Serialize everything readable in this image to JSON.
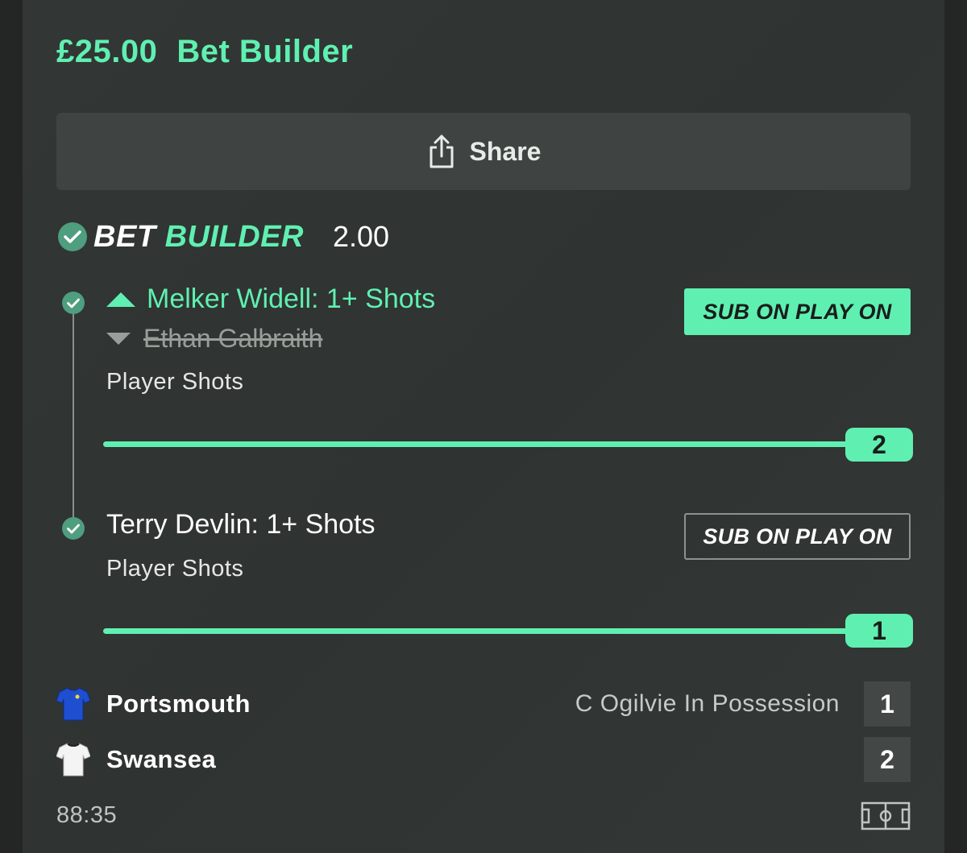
{
  "header": {
    "stake": "£25.00",
    "title": "Bet Builder"
  },
  "share": {
    "label": "Share",
    "icon": "share-icon"
  },
  "bet_builder": {
    "logo_part1": "BET",
    "logo_part2": "BUILDER",
    "odds": "2.00"
  },
  "legs": [
    {
      "title": "Melker Widell: 1+ Shots",
      "replaced_player": "Ethan Galbraith",
      "market": "Player Shots",
      "sub_on_label": "SUB ON PLAY ON",
      "sub_on_active": true,
      "progress_value": "2",
      "progress_fraction": 1.0
    },
    {
      "title": "Terry Devlin: 1+ Shots",
      "market": "Player Shots",
      "sub_on_label": "SUB ON PLAY ON",
      "sub_on_active": false,
      "progress_value": "1",
      "progress_fraction": 1.0
    }
  ],
  "match": {
    "home": {
      "name": "Portsmouth",
      "score": "1",
      "kit_color": "#1f4fd1"
    },
    "away": {
      "name": "Swansea",
      "score": "2",
      "kit_color": "#f4f4f4"
    },
    "status": "C Ogilvie In Possession",
    "clock": "88:35"
  },
  "colors": {
    "accent": "#5ff0b1",
    "background": "#2f3331",
    "check": "#4e9e7f"
  }
}
